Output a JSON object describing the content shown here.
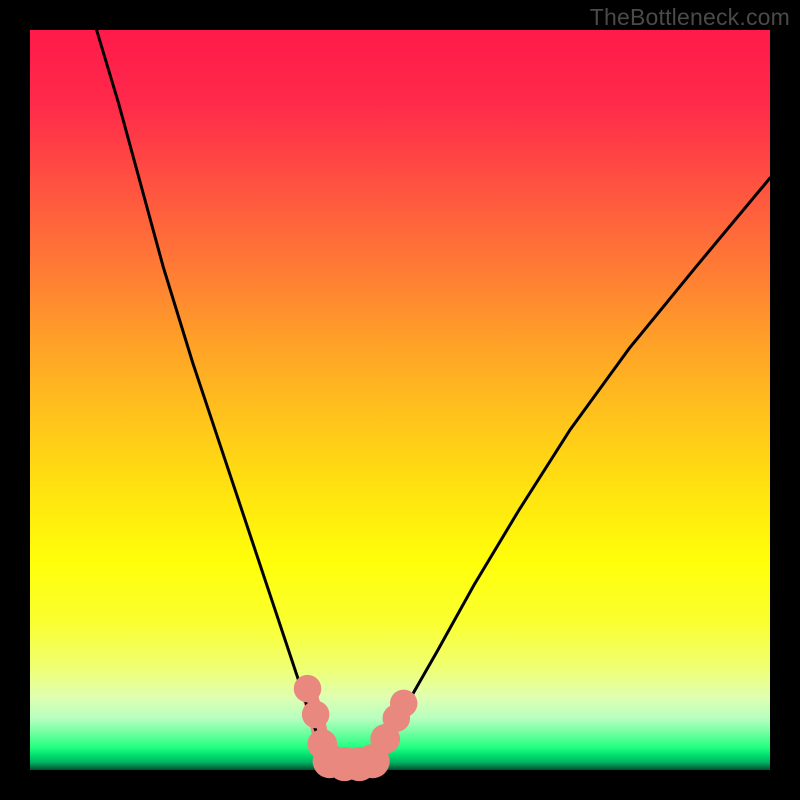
{
  "watermark": "TheBottleneck.com",
  "chart_data": {
    "type": "line",
    "title": "",
    "xlabel": "",
    "ylabel": "",
    "xlim": [
      0,
      100
    ],
    "ylim": [
      0,
      100
    ],
    "series": [
      {
        "name": "left-curve",
        "x": [
          9,
          12,
          15,
          18,
          22,
          26,
          30,
          33,
          36,
          38,
          39.5,
          40.5
        ],
        "values": [
          100,
          90,
          79,
          68,
          55,
          43,
          31,
          22,
          13,
          7,
          3,
          1
        ]
      },
      {
        "name": "right-curve",
        "x": [
          46,
          48,
          51,
          55,
          60,
          66,
          73,
          81,
          90,
          100
        ],
        "values": [
          1,
          4,
          9,
          16,
          25,
          35,
          46,
          57,
          68,
          80
        ]
      },
      {
        "name": "bottom-segment",
        "x": [
          40.5,
          46
        ],
        "values": [
          1,
          1
        ]
      }
    ],
    "markers": [
      {
        "x": 37.5,
        "y": 11,
        "r": 1.4
      },
      {
        "x": 38.6,
        "y": 7.5,
        "r": 1.4
      },
      {
        "x": 39.5,
        "y": 3.5,
        "r": 1.6
      },
      {
        "x": 40.5,
        "y": 1.2,
        "r": 2.0
      },
      {
        "x": 42.5,
        "y": 0.8,
        "r": 2.0
      },
      {
        "x": 44.5,
        "y": 0.8,
        "r": 2.0
      },
      {
        "x": 46.3,
        "y": 1.2,
        "r": 2.0
      },
      {
        "x": 48.0,
        "y": 4.2,
        "r": 1.6
      },
      {
        "x": 49.5,
        "y": 7.0,
        "r": 1.4
      },
      {
        "x": 50.5,
        "y": 9.0,
        "r": 1.4
      }
    ],
    "marker_color": "#e8887e",
    "curve_color": "#000000"
  }
}
